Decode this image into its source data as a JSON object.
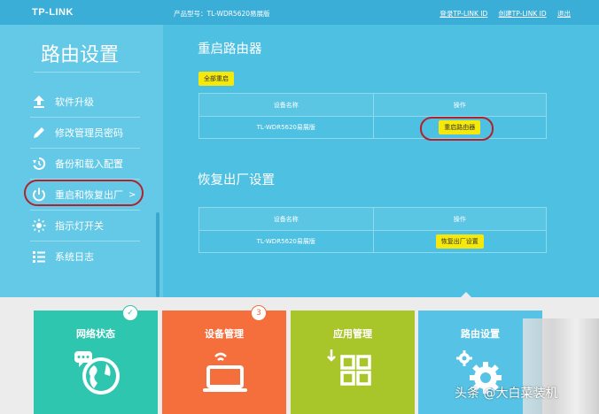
{
  "header": {
    "logo": "TP-LINK",
    "model_label": "产品型号：TL-WDR5620易展版",
    "links": [
      "登录TP-LINK ID",
      "创建TP-LINK ID",
      "退出"
    ]
  },
  "sidebar": {
    "title": "路由设置",
    "items": [
      {
        "label": "软件升级",
        "icon": "upload-icon"
      },
      {
        "label": "修改管理员密码",
        "icon": "pencil-icon"
      },
      {
        "label": "备份和载入配置",
        "icon": "restore-icon"
      },
      {
        "label": "重启和恢复出厂",
        "icon": "power-icon",
        "active": true,
        "chevron": ">"
      },
      {
        "label": "指示灯开关",
        "icon": "light-icon"
      },
      {
        "label": "系统日志",
        "icon": "log-list-icon"
      }
    ]
  },
  "reboot_section": {
    "title": "重启路由器",
    "reboot_all_label": "全部重启",
    "headers": [
      "设备名称",
      "操作"
    ],
    "device": "TL-WDR5620易展版",
    "action_label": "重启路由器"
  },
  "factory_section": {
    "title": "恢复出厂设置",
    "headers": [
      "设备名称",
      "操作"
    ],
    "device": "TL-WDR5620易展版",
    "action_label": "恢复出厂设置"
  },
  "tiles": [
    {
      "label": "网络状态",
      "color": "#2fc6b0",
      "badge": "✓",
      "icon": "globe-icon"
    },
    {
      "label": "设备管理",
      "color": "#f46f3c",
      "badge": "3",
      "icon": "laptop-icon"
    },
    {
      "label": "应用管理",
      "color": "#a8c52a",
      "icon": "apps-grid-icon"
    },
    {
      "label": "路由设置",
      "color": "#56c3e6",
      "icon": "gears-icon"
    }
  ],
  "watermark": "头条 @大白菜装机",
  "colors": {
    "accent_ring": "#b0222c",
    "button_yellow": "#f5e80a",
    "panel": "#4ec0e2"
  }
}
